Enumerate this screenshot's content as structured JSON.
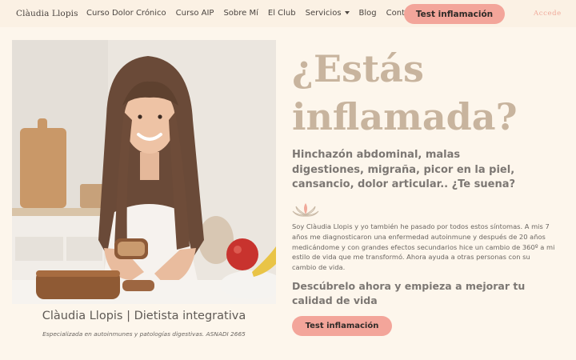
{
  "nav": {
    "brand": "Clàudia Llopis",
    "items": [
      {
        "label": "Curso Dolor Crónico"
      },
      {
        "label": "Curso AIP"
      },
      {
        "label": "Sobre Mí"
      },
      {
        "label": "El Club"
      },
      {
        "label": "Servicios",
        "has_dropdown": true
      },
      {
        "label": "Blog"
      },
      {
        "label": "Contacto"
      }
    ],
    "cta_label": "Test inflamación",
    "login_label": "Accede"
  },
  "hero": {
    "caption_name": "Clàudia Llopis | Dietista integrativa",
    "caption_sub": "Especializada en autoinmunes y patologías digestivas. ASNADI 2665",
    "title_line1": "¿Estás",
    "title_line2": "inflamada?",
    "intro": "Hinchazón abdominal, malas digestiones, migraña, picor en la piel, cansancio, dolor articular.. ¿Te suena?",
    "bio": "Soy Clàudia Llopis y yo también he pasado por todos estos síntomas. A mis 7 años me diagnosticaron una enfermedad autoinmune y después de 20 años medicándome y con grandes efectos secundarios hice un cambio de 360º a mi estilo de vida que me transformó. Ahora ayuda a otras personas con su cambio de vida.",
    "discover": "Descúbrelo ahora y empieza a mejorar tu calidad de vida",
    "cta_label": "Test inflamación"
  },
  "colors": {
    "background": "#fdf6ec",
    "nav_background": "#fbf1e4",
    "accent_button": "#f3a59a",
    "title": "#c8b49e",
    "login": "#f0a99a"
  },
  "icons": {
    "dropdown": "chevron-down-icon",
    "lotus": "lotus-icon"
  }
}
